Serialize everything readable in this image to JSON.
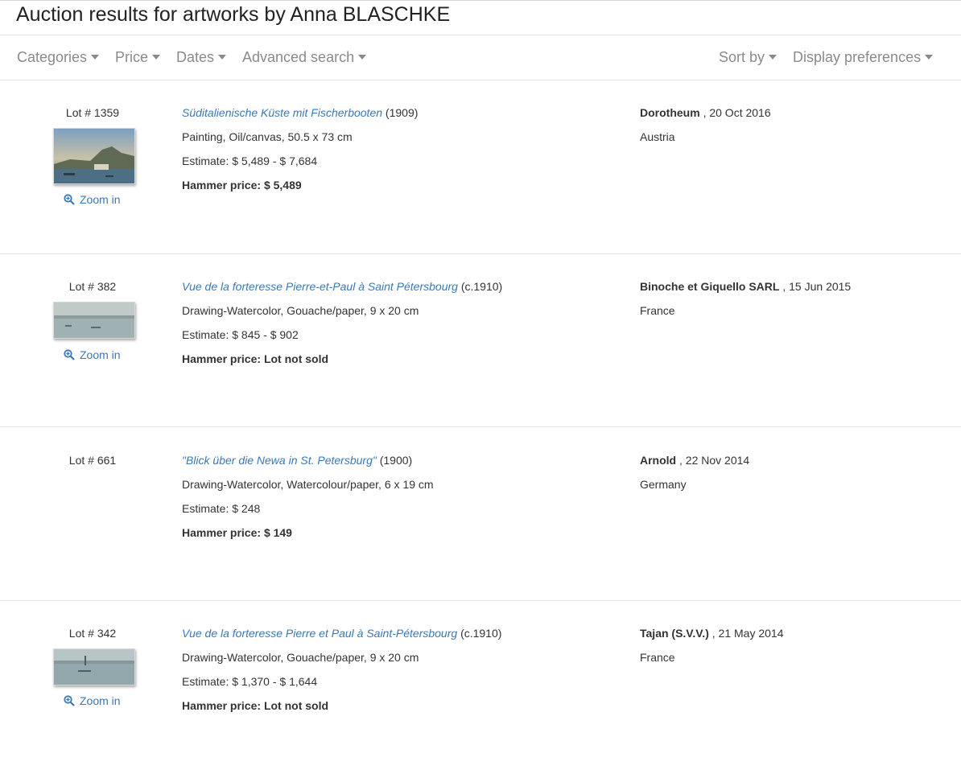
{
  "page_title": "Auction results for artworks by Anna BLASCHKE",
  "toolbar": {
    "categories": "Categories",
    "price": "Price",
    "dates": "Dates",
    "advanced_search": "Advanced search",
    "sort_by": "Sort by",
    "display_preferences": "Display preferences"
  },
  "zoom_label": "Zoom in",
  "lots": [
    {
      "lot": "Lot # 1359",
      "title": "Süditalienische Küste mit Fischerbooten",
      "year": "(1909)",
      "medium": "Painting, Oil/canvas, 50.5 x 73 cm",
      "estimate": "Estimate: $ 5,489 - $ 7,684",
      "hammer_label": "Hammer price:",
      "hammer_value": "$ 5,489",
      "house": "Dorotheum",
      "date": ", 20 Oct 2016",
      "country": "Austria"
    },
    {
      "lot": "Lot # 382",
      "title": "Vue de la forteresse Pierre-et-Paul à Saint Pétersbourg",
      "year": "(c.1910)",
      "medium": "Drawing-Watercolor, Gouache/paper, 9 x 20 cm",
      "estimate": "Estimate: $ 845 - $ 902",
      "hammer_label": "Hammer price:",
      "hammer_value": "Lot not sold",
      "house": "Binoche et Giquello SARL",
      "date": ", 15 Jun 2015",
      "country": "France"
    },
    {
      "lot": "Lot # 661",
      "title": "\"Blick über die Newa in St. Petersburg\"",
      "year": "(1900)",
      "medium": "Drawing-Watercolor, Watercolour/paper, 6 x 19 cm",
      "estimate": "Estimate: $ 248",
      "hammer_label": "Hammer price:",
      "hammer_value": "$ 149",
      "house": "Arnold",
      "date": ", 22 Nov 2014",
      "country": "Germany"
    },
    {
      "lot": "Lot # 342",
      "title": "Vue de la forteresse Pierre et Paul à Saint-Pétersbourg",
      "year": "(c.1910)",
      "medium": "Drawing-Watercolor, Gouache/paper, 9 x 20 cm",
      "estimate": "Estimate: $ 1,370 - $ 1,644",
      "hammer_label": "Hammer price:",
      "hammer_value": "Lot not sold",
      "house": "Tajan (S.V.V.)",
      "date": ", 21 May 2014",
      "country": "France"
    }
  ]
}
